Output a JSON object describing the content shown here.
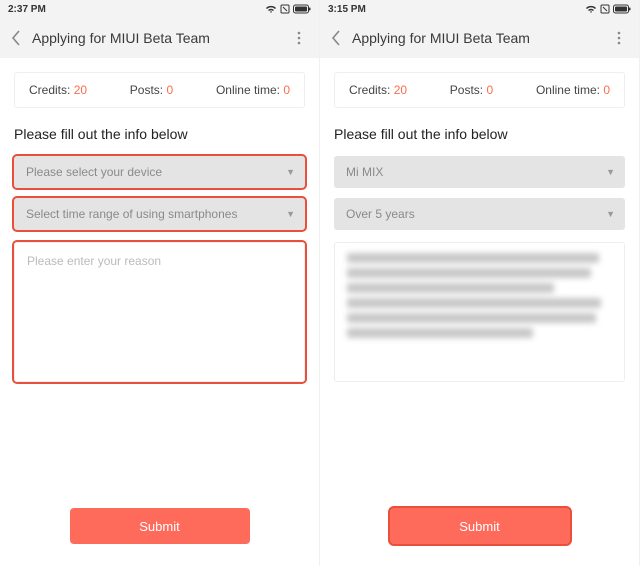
{
  "left": {
    "status_time": "2:37 PM",
    "title": "Applying for MIUI Beta Team",
    "stats": {
      "credits_label": "Credits:",
      "credits_value": "20",
      "posts_label": "Posts:",
      "posts_value": "0",
      "online_label": "Online time:",
      "online_value": "0"
    },
    "prompt": "Please fill out the info below",
    "device_placeholder": "Please select your device",
    "range_placeholder": "Select time range of using smartphones",
    "reason_placeholder": "Please enter your reason",
    "submit": "Submit"
  },
  "right": {
    "status_time": "3:15 PM",
    "title": "Applying for MIUI Beta Team",
    "stats": {
      "credits_label": "Credits:",
      "credits_value": "20",
      "posts_label": "Posts:",
      "posts_value": "0",
      "online_label": "Online time:",
      "online_value": "0"
    },
    "prompt": "Please fill out the info below",
    "device_value": "Mi MIX",
    "range_value": "Over 5 years",
    "submit": "Submit"
  }
}
